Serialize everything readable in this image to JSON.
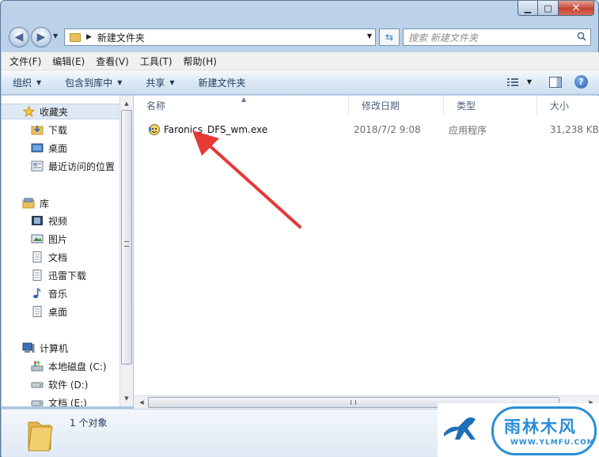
{
  "address": {
    "path": "新建文件夹"
  },
  "search": {
    "placeholder": "搜索 新建文件夹"
  },
  "menu": [
    "文件(F)",
    "编辑(E)",
    "查看(V)",
    "工具(T)",
    "帮助(H)"
  ],
  "toolbar": {
    "organize": "组织",
    "include_library": "包含到库中",
    "share": "共享",
    "new_folder": "新建文件夹"
  },
  "nav": {
    "favorites": {
      "label": "收藏夹",
      "items": [
        "下载",
        "桌面",
        "最近访问的位置"
      ]
    },
    "libraries": {
      "label": "库",
      "items": [
        "视频",
        "图片",
        "文档",
        "迅雷下载",
        "音乐",
        "桌面"
      ]
    },
    "computer": {
      "label": "计算机",
      "items": [
        "本地磁盘 (C:)",
        "软件 (D:)",
        "文档 (E:)"
      ]
    }
  },
  "columns": {
    "name": "名称",
    "date": "修改日期",
    "type": "类型",
    "size": "大小"
  },
  "files": [
    {
      "name": "Faronics_DFS_wm.exe",
      "date": "2018/7/2 9:08",
      "type": "应用程序",
      "size": "31,238 KB"
    }
  ],
  "status": {
    "count": "1 个对象"
  },
  "watermark": {
    "text": "雨林木风",
    "url": "WWW.YLMFU.COM"
  },
  "colors": {
    "accent": "#2a8ed8",
    "arrow": "#e53935",
    "toolbar_text": "#1e395b"
  }
}
